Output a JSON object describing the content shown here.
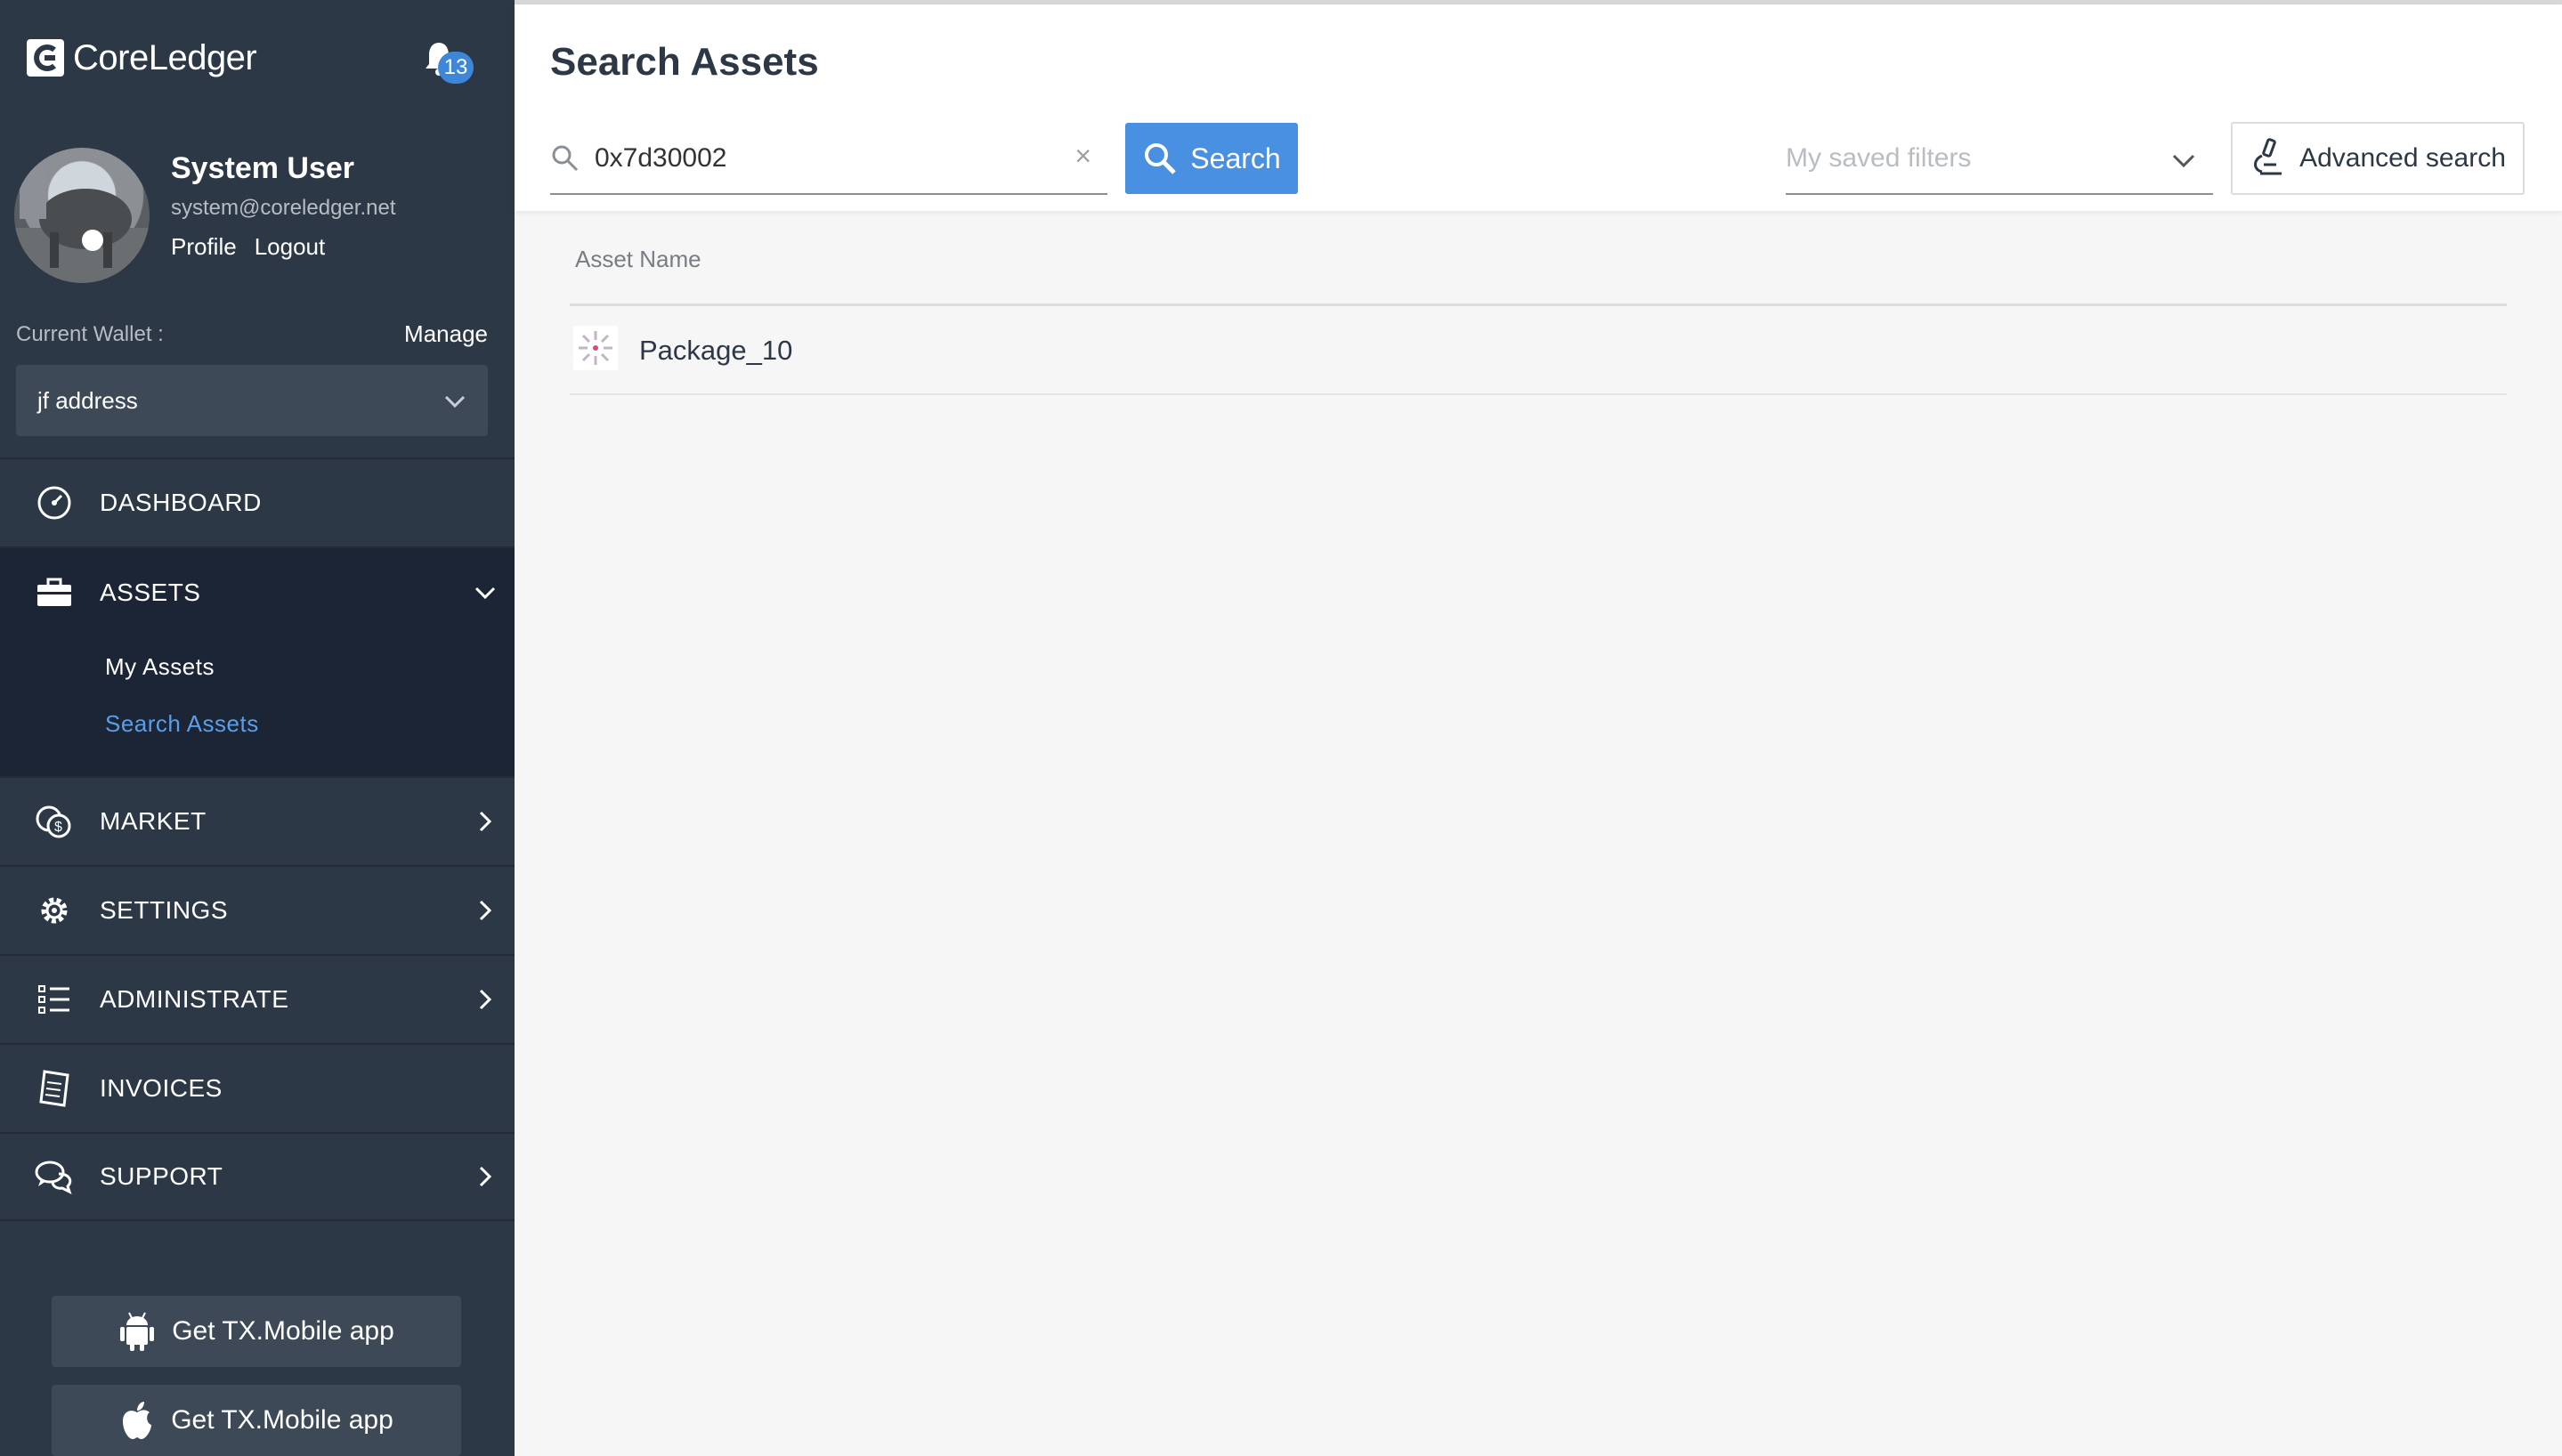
{
  "brand": {
    "name": "CoreLedger"
  },
  "notifications": {
    "count": "13"
  },
  "user": {
    "name": "System User",
    "email": "system@coreledger.net",
    "links": [
      "Profile",
      "Logout"
    ]
  },
  "wallet": {
    "label": "Current Wallet :",
    "manage": "Manage",
    "selected": "jf address"
  },
  "nav": {
    "dashboard": "DASHBOARD",
    "assets": "ASSETS",
    "assets_sub": [
      "My Assets",
      "Search Assets"
    ],
    "market": "MARKET",
    "settings": "SETTINGS",
    "administrate": "ADMINISTRATE",
    "invoices": "INVOICES",
    "support": "SUPPORT"
  },
  "apps": {
    "android": "Get TX.Mobile app",
    "ios": "Get TX.Mobile app"
  },
  "page": {
    "title": "Search Assets"
  },
  "search": {
    "value": "0x7d30002",
    "clear": "×",
    "button": "Search"
  },
  "filters": {
    "placeholder": "My saved filters",
    "advanced": "Advanced search"
  },
  "table": {
    "column": "Asset Name",
    "rows": [
      {
        "name": "Package_10"
      }
    ]
  },
  "colors": {
    "sidebar": "#2d3846",
    "sidebar_active": "#1b2535",
    "accent": "#4a90e2",
    "link_active": "#5a9ee8"
  }
}
